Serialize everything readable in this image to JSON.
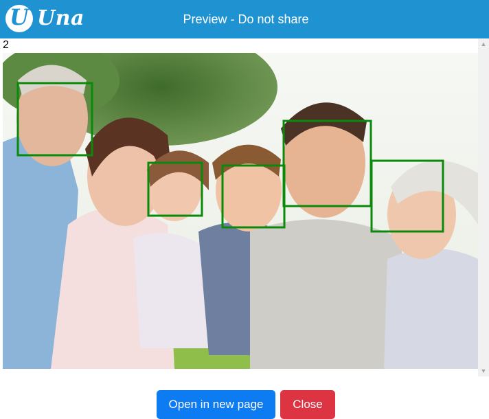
{
  "header": {
    "logo_letter": "U",
    "logo_text": "Una",
    "title": "Preview - Do not share",
    "color": "#1f93d2"
  },
  "preview": {
    "counter": "2",
    "photo_description_icon": "family-photo",
    "face_box_color": "#0a8a0a"
  },
  "scrollbar": {
    "up_icon": "▲",
    "down_icon": "▼"
  },
  "buttons": {
    "open_label": "Open in new page",
    "close_label": "Close",
    "open_color": "#0d7bf2",
    "close_color": "#dc3442"
  }
}
